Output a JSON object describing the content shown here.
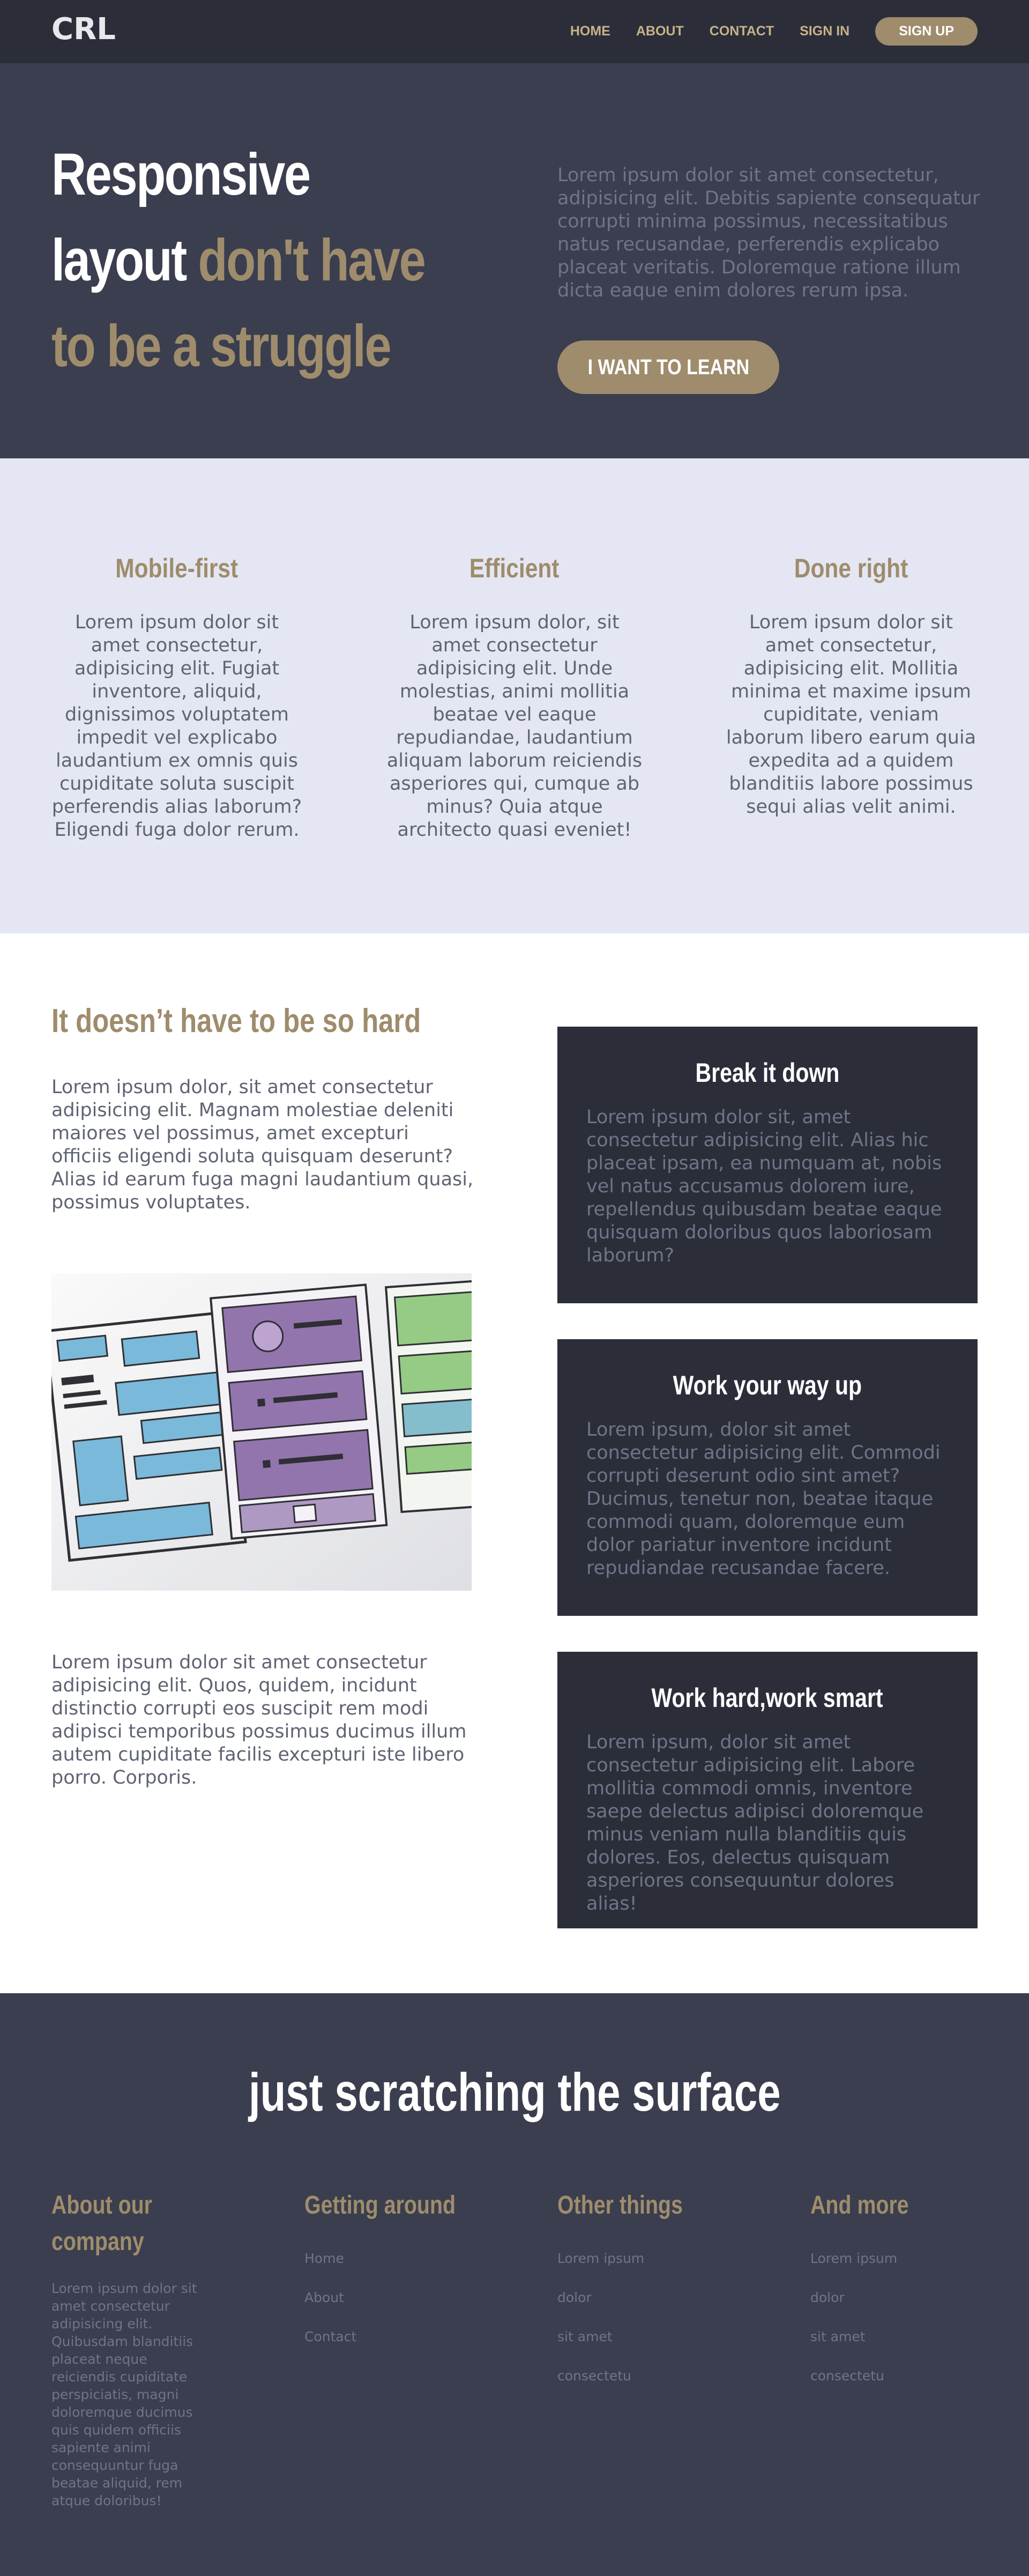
{
  "nav": {
    "logo": "CRL",
    "links": [
      "HOME",
      "ABOUT",
      "CONTACT",
      "SIGN IN"
    ],
    "signup_label": "SIGN UP"
  },
  "hero": {
    "title_line1": "Responsive",
    "title_line2_white": "layout ",
    "title_line2_accent": "don't have",
    "title_line3": "to be a struggle",
    "text": "Lorem ipsum dolor sit amet consectetur, adipisicing elit. Debitis sapiente consequatur corrupti minima possimus, necessitatibus natus recusandae, perferendis explicabo placeat veritatis. Doloremque ratione illum dicta eaque enim dolores rerum ipsa.",
    "button_label": "I WANT TO LEARN"
  },
  "features": [
    {
      "title": "Mobile-first",
      "text": "Lorem ipsum dolor sit amet consectetur, adipisicing elit. Fugiat inventore, aliquid, dignissimos voluptatem impedit vel explicabo laudantium ex omnis quis cupiditate soluta suscipit perferendis alias laborum? Eligendi fuga dolor rerum."
    },
    {
      "title": "Efficient",
      "text": "Lorem ipsum dolor, sit amet consectetur adipisicing elit. Unde molestias, animi mollitia beatae vel eaque repudiandae, laudantium aliquam laborum reiciendis asperiores qui, cumque ab minus? Quia atque architecto quasi eveniet!"
    },
    {
      "title": "Done right",
      "text": "Lorem ipsum dolor sit amet consectetur, adipisicing elit. Mollitia minima et maxime ipsum cupiditate, veniam laborum libero earum quia expedita ad a quidem blanditiis labore possimus sequi alias velit animi."
    }
  ],
  "content": {
    "title": "It doesn’t have to be so hard",
    "paragraph1": "Lorem ipsum dolor, sit amet consectetur adipisicing elit. Magnam molestiae deleniti maiores vel possimus, amet excepturi officiis eligendi soluta quisquam deserunt? Alias id earum fuga magni laudantium quasi, possimus voluptates.",
    "paragraph2": "Lorem ipsum dolor sit amet consectetur adipisicing elit. Quos, quidem, incidunt distinctio corrupti eos suscipit rem modi adipisci temporibus possimus ducimus illum autem cupiditate facilis excepturi iste libero porro. Corporis.",
    "cards": [
      {
        "title": "Break it down",
        "text": "Lorem ipsum dolor sit, amet consectetur adipisicing elit. Alias hic placeat ipsam, ea numquam at, nobis vel natus accusamus dolorem iure, repellendus quibusdam beatae eaque quisquam doloribus quos laboriosam laborum?"
      },
      {
        "title": "Work your way up",
        "text": "Lorem ipsum, dolor sit amet consectetur adipisicing elit. Commodi corrupti deserunt odio sint amet? Ducimus, tenetur non, beatae itaque commodi quam, doloremque eum dolor pariatur inventore incidunt repudiandae recusandae facere."
      },
      {
        "title": "Work hard,work smart",
        "text": "Lorem ipsum, dolor sit amet consectetur adipisicing elit. Labore mollitia commodi omnis, inventore saepe delectus adipisci doloremque minus veniam nulla blanditiis quis dolores. Eos, delectus quisquam asperiores consequuntur dolores alias!"
      }
    ]
  },
  "footer": {
    "title": "just scratching the surface",
    "about": {
      "title": "About our company",
      "text": "Lorem ipsum dolor sit amet consectetur adipisicing elit. Quibusdam blanditiis placeat neque reiciendis cupiditate perspiciatis, magni doloremque ducimus quis quidem officiis sapiente animi consequuntur fuga beatae aliquid, rem atque doloribus!"
    },
    "columns": [
      {
        "title": "Getting around",
        "links": [
          "Home",
          "About",
          "Contact"
        ]
      },
      {
        "title": "Other things",
        "links": [
          "Lorem ipsum",
          "dolor",
          "sit amet",
          "consectetu"
        ]
      },
      {
        "title": "And more",
        "links": [
          "Lorem ipsum",
          "dolor",
          "sit amet",
          "consectetu"
        ]
      }
    ]
  },
  "colors": {
    "nav_bg": "#2b2e39",
    "hero_bg": "#3a3e4e",
    "accent": "#9e8c6c",
    "features_bg": "#e4e7f3",
    "card_bg": "#2b2e39",
    "footer_bg": "#3a3e4e"
  }
}
